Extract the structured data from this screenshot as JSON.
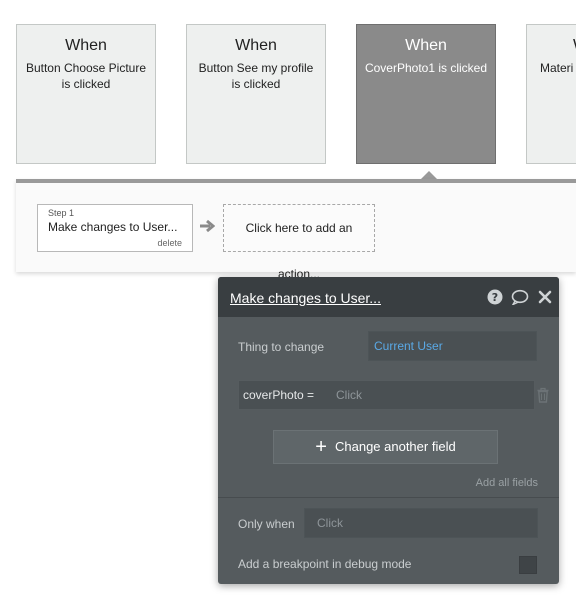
{
  "events": [
    {
      "when": "When",
      "description": "Button Choose Picture is clicked",
      "selected": false
    },
    {
      "when": "When",
      "description": "Button See my profile is clicked",
      "selected": false
    },
    {
      "when": "When",
      "description": "CoverPhoto1 is clicked",
      "selected": true
    },
    {
      "when": "W",
      "description": "Materi",
      "selected": false
    }
  ],
  "action_bar": {
    "step_number": "Step 1",
    "step_title": "Make changes to User...",
    "step_delete": "delete",
    "add_action": "Click here to add an action..."
  },
  "panel": {
    "title": "Make changes to User...",
    "icons": [
      "help-icon",
      "comment-icon",
      "close-icon"
    ],
    "thing_label": "Thing to change",
    "thing_value": "Current User",
    "field_name": "coverPhoto",
    "field_op": "=",
    "field_placeholder": "Click",
    "change_button": "Change another field",
    "add_all": "Add all fields",
    "only_when_label": "Only when",
    "only_when_placeholder": "Click",
    "breakpoint_label": "Add a breakpoint in debug mode"
  },
  "colors": {
    "accent_blue": "#5aa9e6",
    "panel_bg": "#555b5e",
    "panel_header": "#393e41",
    "selected_card": "#8a8a8a"
  }
}
